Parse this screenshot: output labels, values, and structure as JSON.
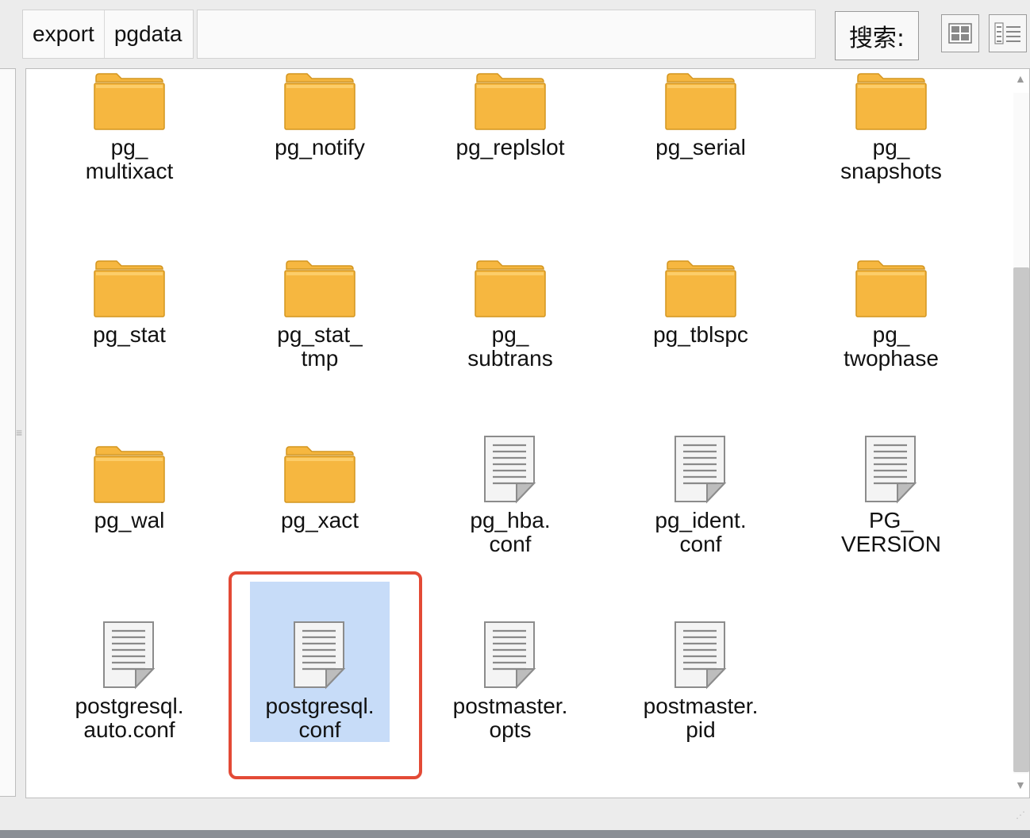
{
  "breadcrumb": [
    "export",
    "pgdata"
  ],
  "search": {
    "label": "搜索:"
  },
  "view_buttons": [
    "grid-view-icon",
    "list-view-icon"
  ],
  "colors": {
    "folder": "#f6b740",
    "selection": "#c7dcf8",
    "highlight_border": "#e34a36"
  },
  "files": [
    {
      "label": "pg_\nmultixact",
      "type": "folder"
    },
    {
      "label": "pg_notify",
      "type": "folder"
    },
    {
      "label": "pg_replslot",
      "type": "folder"
    },
    {
      "label": "pg_serial",
      "type": "folder"
    },
    {
      "label": "pg_\nsnapshots",
      "type": "folder"
    },
    {
      "label": "pg_stat",
      "type": "folder"
    },
    {
      "label": "pg_stat_\ntmp",
      "type": "folder"
    },
    {
      "label": "pg_\nsubtrans",
      "type": "folder"
    },
    {
      "label": "pg_tblspc",
      "type": "folder"
    },
    {
      "label": "pg_\ntwophase",
      "type": "folder"
    },
    {
      "label": "pg_wal",
      "type": "folder"
    },
    {
      "label": "pg_xact",
      "type": "folder"
    },
    {
      "label": "pg_hba.\nconf",
      "type": "file"
    },
    {
      "label": "pg_ident.\nconf",
      "type": "file"
    },
    {
      "label": "PG_\nVERSION",
      "type": "file"
    },
    {
      "label": "postgresql.\nauto.conf",
      "type": "file"
    },
    {
      "label": "postgresql.\nconf",
      "type": "file",
      "selected": true
    },
    {
      "label": "postmaster.\nopts",
      "type": "file"
    },
    {
      "label": "postmaster.\npid",
      "type": "file"
    }
  ]
}
